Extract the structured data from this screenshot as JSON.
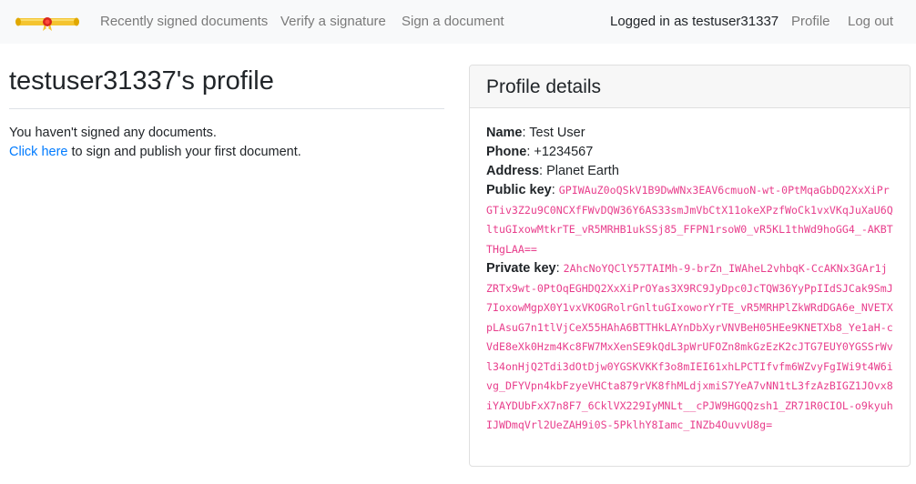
{
  "nav": {
    "logo_icon": "diploma-scroll-icon",
    "links": [
      "Recently signed documents",
      "Verify a signature",
      "Sign a document"
    ],
    "status": "Logged in as testuser31337",
    "profile": "Profile",
    "logout": "Log out"
  },
  "page": {
    "title": "testuser31337's profile",
    "empty_text": "You haven't signed any documents.",
    "cta_link": "Click here",
    "cta_suffix": " to sign and publish your first document."
  },
  "details": {
    "header": "Profile details",
    "name_label": "Name",
    "name_value": "Test User",
    "phone_label": "Phone",
    "phone_value": "+1234567",
    "address_label": "Address",
    "address_value": "Planet Earth",
    "public_key_label": "Public key",
    "public_key_value": "GPIWAuZ0oQSkV1B9DwWNx3EAV6cmuoN-wt-0PtMqaGbDQ2XxXiPrGTiv3Z2u9C0NCXfFWvDQW36Y6AS33smJmVbCtX11okeXPzfWoCk1vxVKqJuXaU6QltuGIxowMtkrTE_vR5MRHB1ukSSj85_FFPN1rsoW0_vR5KL1thWd9hoGG4_-AKBTTHgLAA==",
    "private_key_label": "Private key",
    "private_key_value": "2AhcNoYQClY57TAIMh-9-brZn_IWAheL2vhbqK-CcAKNx3GAr1jZRTx9wt-0PtOqEGHDQ2XxXiPrOYas3X9RC9JyDpc0JcTQW36YyPpIIdSJCak9SmJ7IoxowMgpX0Y1vxVKOGRolrGnltuGIxoworYrTE_vR5MRHPlZkWRdDGA6e_NVETXpLAsuG7n1tlVjCeX55HAhA6BTTHkLAYnDbXyrVNVBeH05HEe9KNETXb8_Ye1aH-cVdE8eXk0Hzm4Kc8FW7MxXenSE9kQdL3pWrUFOZn8mkGzEzK2cJTG7EUY0YGSSrWvl34onHjQ2Tdi3dOtDjw0YGSKVKKf3o8mIEI61xhLPCTIfvfm6WZvyFgIWi9t4W6ivg_DFYVpn4kbFzyeVHCta879rVK8fhMLdjxmiS7YeA7vNN1tL3fzAzBIGZ1JOvx8iYAYDUbFxX7n8F7_6CklVX229IyMNLt__cPJW9HGQQzsh1_ZR71R0CIOL-o9kyuhIJWDmqVrl2UeZAH9i0S-5PklhY8Iamc_INZb4OuvvU8g="
  },
  "colors": {
    "accent": "#007bff",
    "code": "#e83e8c",
    "nav_bg": "#f8f9fa",
    "nav_text": "#7a7a7a"
  }
}
